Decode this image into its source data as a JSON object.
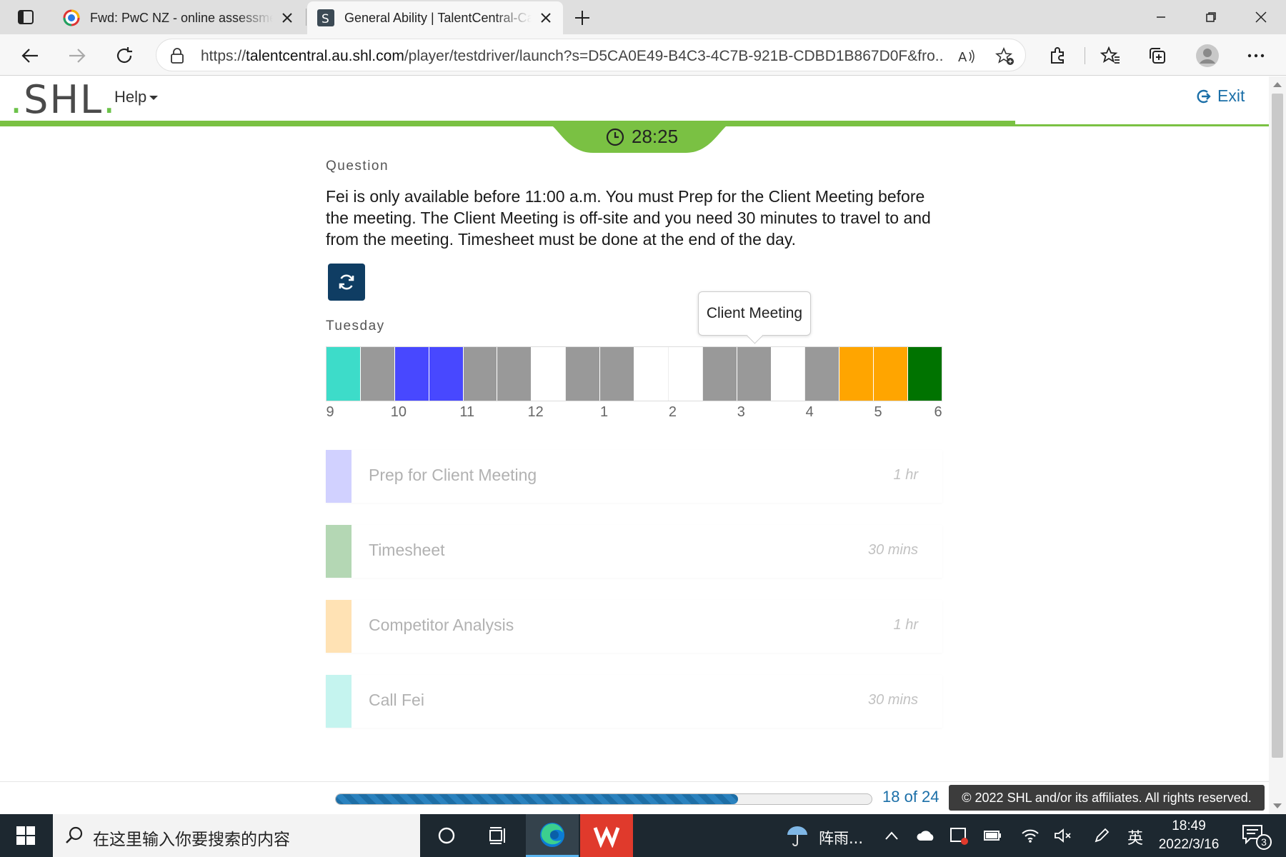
{
  "browser": {
    "tabs": [
      {
        "title": "Fwd: PwC NZ - online assessment",
        "icon": "gmail-icon",
        "active": false
      },
      {
        "title": "General Ability | TalentCentral-Candidate",
        "icon": "shl-favicon",
        "active": true
      }
    ],
    "url_prefix": "https://",
    "url_host": "talentcentral.au.shl.com",
    "url_path": "/player/testdriver/launch?s=D5CA0E49-B4C3-4C7B-921B-CDBD1B867D0F&fro..."
  },
  "app": {
    "logo": "SHL",
    "help_label": "Help",
    "exit_label": "Exit",
    "timer": "28:25",
    "top_progress_fraction": 0.8,
    "accent": "#7ac143",
    "brand_blue": "#1b6fa8"
  },
  "question": {
    "heading": "Question",
    "text": "Fei is only available before 11:00 a.m. You must Prep for the Client Meeting before the meeting. The Client Meeting is off-site and you need 30 minutes to travel to and from the meeting. Timesheet must be done at the end of the day."
  },
  "schedule": {
    "day": "Tuesday",
    "tooltip": "Client Meeting",
    "slots": [
      "#3ddcc9",
      "#999999",
      "#4848ff",
      "#4848ff",
      "#999999",
      "#999999",
      "#ffffff",
      "#999999",
      "#999999",
      "#ffffff",
      "#ffffff",
      "#999999",
      "#999999",
      "#ffffff",
      "#999999",
      "#ffa500",
      "#ffa500",
      "#007300"
    ],
    "hour_labels": [
      {
        "label": "9",
        "slot": 0
      },
      {
        "label": "10",
        "slot": 2
      },
      {
        "label": "11",
        "slot": 4
      },
      {
        "label": "12",
        "slot": 6
      },
      {
        "label": "1",
        "slot": 8
      },
      {
        "label": "2",
        "slot": 10
      },
      {
        "label": "3",
        "slot": 12
      },
      {
        "label": "4",
        "slot": 14
      },
      {
        "label": "5",
        "slot": 16
      },
      {
        "label": "6",
        "slot": 18
      }
    ]
  },
  "tasks": [
    {
      "name": "Prep for Client Meeting",
      "duration": "1 hr",
      "color": "#9b9bff"
    },
    {
      "name": "Timesheet",
      "duration": "30 mins",
      "color": "#5aa85a"
    },
    {
      "name": "Competitor Analysis",
      "duration": "1 hr",
      "color": "#ffbf5a"
    },
    {
      "name": "Call Fei",
      "duration": "30 mins",
      "color": "#7fe8dc"
    }
  ],
  "footer": {
    "progress_text": "18 of 24",
    "progress_fraction": 0.75,
    "copyright": "© 2022 SHL and/or its affiliates. All rights reserved."
  },
  "taskbar": {
    "search_placeholder": "在这里输入你要搜索的内容",
    "weather": "阵雨...",
    "ime": "英",
    "time": "18:49",
    "date": "2022/3/16",
    "notifications": "3"
  }
}
